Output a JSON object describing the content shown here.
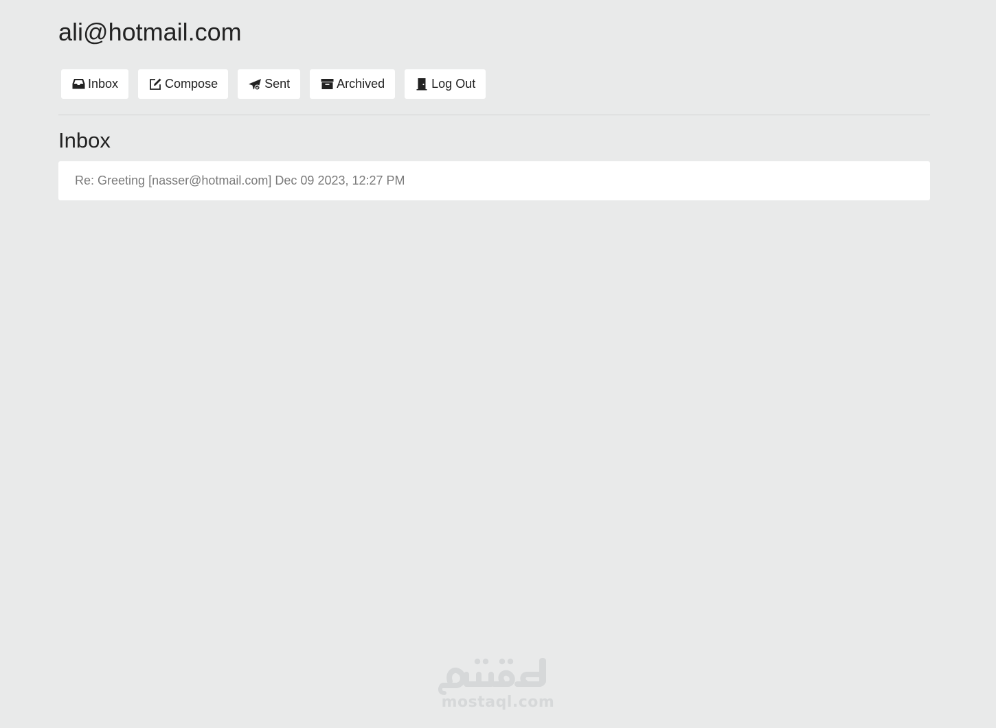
{
  "header": {
    "user_email": "ali@hotmail.com"
  },
  "nav": {
    "items": [
      {
        "label": "Inbox",
        "icon": "inbox-icon"
      },
      {
        "label": "Compose",
        "icon": "compose-icon"
      },
      {
        "label": "Sent",
        "icon": "send-icon"
      },
      {
        "label": "Archived",
        "icon": "archive-icon"
      },
      {
        "label": "Log Out",
        "icon": "door-icon"
      }
    ]
  },
  "main": {
    "title": "Inbox",
    "emails": [
      {
        "subject": "Re: Greeting",
        "sender": "[nasser@hotmail.com]",
        "timestamp": "Dec 09 2023, 12:27 PM",
        "read": true
      }
    ]
  },
  "watermark": {
    "text": "mostaql.com",
    "logo": "مستقل"
  },
  "colors": {
    "background": "#e9eaea",
    "card": "#ffffff",
    "text": "#222222",
    "muted_text": "#7a7a7a",
    "watermark": "#d6d8d9"
  }
}
